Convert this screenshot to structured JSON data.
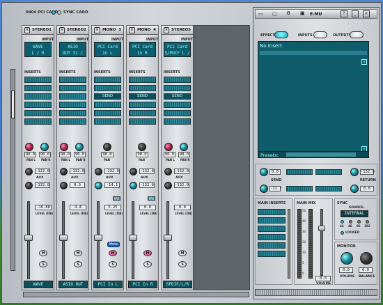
{
  "header": {
    "card": "0404 PCI CARD",
    "sync": "SYNC CARD",
    "brand": "E-MU"
  },
  "strips": [
    {
      "type": "STEREO",
      "num": "1",
      "input": [
        "WAVE",
        "L / R"
      ],
      "insert": "",
      "pan": [
        "90.0",
        "90.0"
      ],
      "pan_labels": [
        "PAN L",
        "PAN R"
      ],
      "aux": [
        "-132.0",
        "-132.0"
      ],
      "level": "-16.88",
      "name": "WAVE",
      "color": "red"
    },
    {
      "type": "STEREO",
      "num": "2",
      "input": [
        "ASIO",
        "OUT 31 / 32"
      ],
      "insert": "",
      "pan": [
        "90.0",
        "90.0"
      ],
      "pan_labels": [
        "PAN L",
        "PAN R"
      ],
      "aux": [
        "-132.0",
        "0.0"
      ],
      "level": "4.4",
      "name": "ASIO OUT",
      "color": "red"
    },
    {
      "type": "MONO",
      "num": "3",
      "input": [
        "PCI Card",
        "In L"
      ],
      "insert": "SEND",
      "pan": [
        "90.0"
      ],
      "pan_labels": [
        "PAN"
      ],
      "aux": [
        "-132.0",
        "-14.1"
      ],
      "level": "5.25",
      "name": "PCI In L",
      "color": "dark",
      "mute": "Mute"
    },
    {
      "type": "MONO",
      "num": "4",
      "input": [
        "PCI Card",
        "In R"
      ],
      "insert": "SEND",
      "pan": [
        "90.0"
      ],
      "pan_labels": [
        "PAN"
      ],
      "aux": [
        "-132.0",
        "-132.0"
      ],
      "level": "0.0",
      "name": "PCI In R",
      "color": "dark"
    },
    {
      "type": "STEREO",
      "num": "5",
      "input": [
        "PCI Card",
        "S/PDIF L / R"
      ],
      "insert": "SEND",
      "pan": [
        "90.0",
        "90.0"
      ],
      "pan_labels": [
        "PAN L",
        "PAN R"
      ],
      "aux": [
        "-132.0",
        "-132.0"
      ],
      "level": "0.0",
      "name": "SPDIF/L/R",
      "color": "red"
    }
  ],
  "labels": {
    "input": "INPUT",
    "inserts": "INSERTS",
    "aux": "AUX",
    "level": "LEVEL (DB)",
    "m": "M",
    "s": "S",
    "pre": "PRE"
  },
  "right": {
    "tabs": [
      "EFFECT",
      "INPUTS",
      "OUTPUTS"
    ],
    "no_insert": "No Insert",
    "presets": "Presets:",
    "send_label": "SEND",
    "send_vals": [
      "0.0",
      "0.0"
    ],
    "return_label": "RETURN",
    "return_vals": [
      "-132.0",
      "0.0"
    ],
    "return_val3": "-11.7",
    "main_inserts": "MAIN INSERTS",
    "main_mix": "MAIN MIX",
    "sync_title": "SYNC",
    "source_label": "SOURCE:",
    "source_value": "INTERNAL",
    "rates": [
      "44",
      "48",
      "96",
      "192"
    ],
    "locked": "LOCKED",
    "monitor_title": "MONITOR",
    "volume_label": "VOLUME",
    "balance_label": "BALANCE",
    "main_volume_label": "VOLUME",
    "monitor_vals": [
      "0.0",
      "0.0"
    ],
    "main_vol": "0.0",
    "scale": [
      "50",
      "40",
      "30",
      "20",
      "10",
      "5",
      "0"
    ]
  }
}
